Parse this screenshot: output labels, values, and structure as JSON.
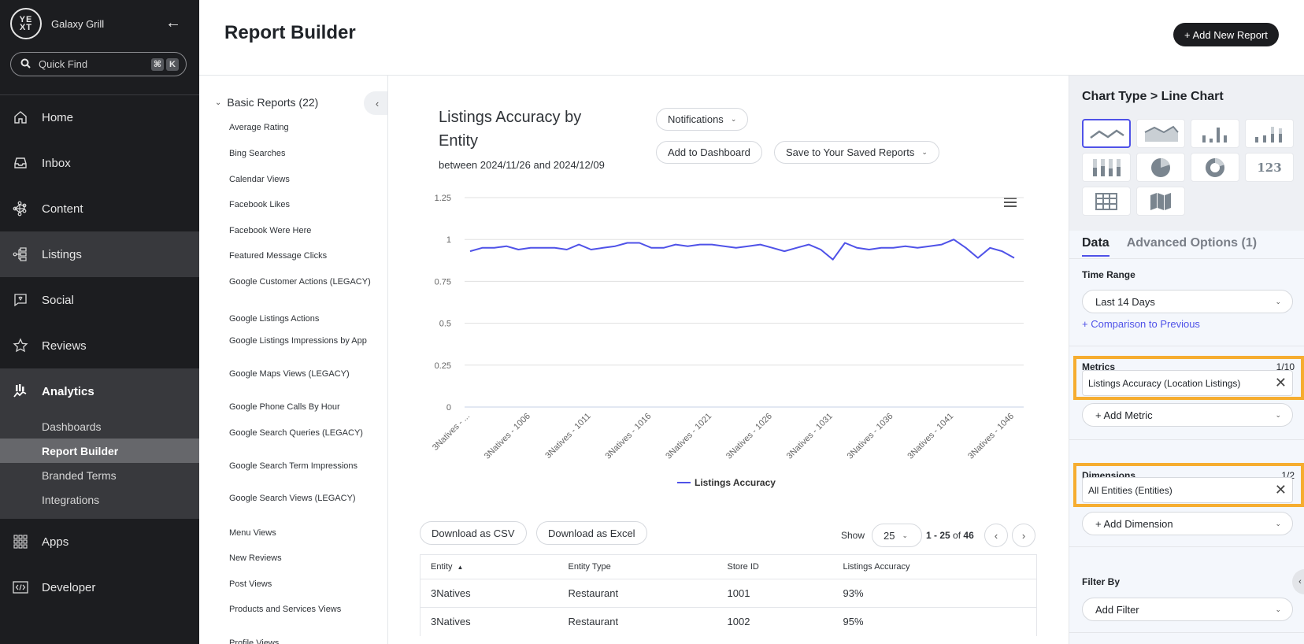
{
  "sidebar": {
    "brand_name": "Galaxy Grill",
    "logo_text": "YEXT",
    "quick_find_placeholder": "Quick Find",
    "shortcut_keys": [
      "⌘",
      "K"
    ],
    "items": [
      {
        "label": "Home",
        "icon": "home-icon"
      },
      {
        "label": "Inbox",
        "icon": "inbox-icon"
      },
      {
        "label": "Content",
        "icon": "content-icon"
      },
      {
        "label": "Listings",
        "icon": "listings-icon"
      },
      {
        "label": "Social",
        "icon": "social-icon"
      },
      {
        "label": "Reviews",
        "icon": "reviews-icon"
      },
      {
        "label": "Analytics",
        "icon": "analytics-icon"
      },
      {
        "label": "Apps",
        "icon": "apps-icon"
      },
      {
        "label": "Developer",
        "icon": "developer-icon"
      }
    ],
    "analytics_sub": [
      "Dashboards",
      "Report Builder",
      "Branded Terms",
      "Integrations"
    ]
  },
  "header": {
    "title": "Report Builder",
    "add_report_label": "+ Add New Report"
  },
  "reports": {
    "group_label": "Basic Reports (22)",
    "items": [
      "Average Rating",
      "Bing Searches",
      "Calendar Views",
      "Facebook Likes",
      "Facebook Were Here",
      "Featured Message Clicks",
      "Google Customer Actions (LEGACY)",
      "Google Listings Actions",
      "Google Listings Impressions by App",
      "Google Maps Views (LEGACY)",
      "Google Phone Calls By Hour",
      "Google Search Queries (LEGACY)",
      "Google Search Term Impressions",
      "Google Search Views (LEGACY)",
      "Menu Views",
      "New Reviews",
      "Post Views",
      "Products and Services Views",
      "Profile Views"
    ]
  },
  "report": {
    "title": "Listings Accuracy by Entity",
    "date_range": "between 2024/11/26 and 2024/12/09",
    "notifications_label": "Notifications",
    "add_dashboard_label": "Add to Dashboard",
    "save_label": "Save to Your Saved Reports"
  },
  "chart_data": {
    "type": "line",
    "title": "",
    "xlabel": "",
    "ylabel": "",
    "ylim": [
      0,
      1.25
    ],
    "yticks": [
      "0",
      "0.25",
      "0.5",
      "0.75",
      "1",
      "1.25"
    ],
    "ytick_values": [
      0,
      0.25,
      0.5,
      0.75,
      1,
      1.25
    ],
    "xtick_labels": [
      "3Natives - ...",
      "3Natives - 1006",
      "3Natives - 1011",
      "3Natives - 1016",
      "3Natives - 1021",
      "3Natives - 1026",
      "3Natives - 1031",
      "3Natives - 1036",
      "3Natives - 1041",
      "3Natives - 1046"
    ],
    "xtick_every": 5,
    "grid": true,
    "legend": "bottom-center",
    "color": "#4f52e8",
    "series": [
      {
        "name": "Listings Accuracy",
        "values": [
          0.93,
          0.95,
          0.95,
          0.96,
          0.94,
          0.95,
          0.95,
          0.95,
          0.94,
          0.97,
          0.94,
          0.95,
          0.96,
          0.98,
          0.98,
          0.95,
          0.95,
          0.97,
          0.96,
          0.97,
          0.97,
          0.96,
          0.95,
          0.96,
          0.97,
          0.95,
          0.93,
          0.95,
          0.97,
          0.94,
          0.88,
          0.98,
          0.95,
          0.94,
          0.95,
          0.95,
          0.96,
          0.95,
          0.96,
          0.97,
          1.0,
          0.95,
          0.89,
          0.95,
          0.93,
          0.89
        ]
      }
    ]
  },
  "table": {
    "download_csv": "Download as CSV",
    "download_excel": "Download as Excel",
    "show_label": "Show",
    "page_size": "25",
    "range_start_end": "1 - 25",
    "range_of": "of",
    "total": "46",
    "columns": [
      "Entity",
      "Entity Type",
      "Store ID",
      "Listings Accuracy"
    ],
    "rows": [
      [
        "3Natives",
        "Restaurant",
        "1001",
        "93%"
      ],
      [
        "3Natives",
        "Restaurant",
        "1002",
        "95%"
      ]
    ]
  },
  "panel": {
    "title": "Chart Type > Line Chart",
    "chart_types": [
      "line",
      "area",
      "bar",
      "grouped-bar",
      "stacked-bar",
      "pie",
      "donut",
      "number",
      "table",
      "map"
    ],
    "number_glyph": "123",
    "tabs": [
      "Data",
      "Advanced Options (1)"
    ],
    "time_range_label": "Time Range",
    "time_range_value": "Last 14 Days",
    "comparison_link": "+ Comparison to Previous",
    "metrics_label": "Metrics",
    "metrics_count": "1/10",
    "metric_chip": "Listings Accuracy (Location Listings)",
    "add_metric": "+ Add Metric",
    "dimensions_label": "Dimensions",
    "dimensions_count": "1/2",
    "dimension_chip": "All Entities (Entities)",
    "add_dimension": "+ Add Dimension",
    "filter_label": "Filter By",
    "filter_value": "Add Filter",
    "highlight_color": "#f6ad30",
    "accent_color": "#4f52e8"
  }
}
